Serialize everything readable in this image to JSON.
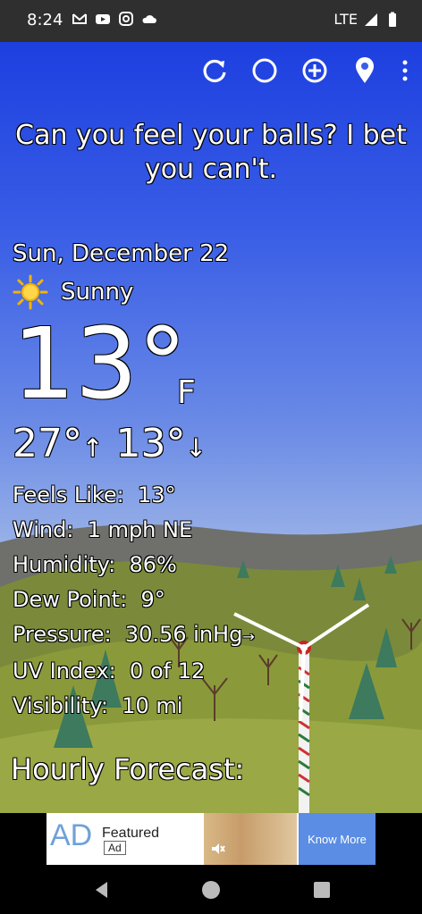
{
  "status_bar": {
    "time": "8:24",
    "network": "LTE",
    "left_icons": [
      "gmail-icon",
      "youtube-icon",
      "instagram-icon",
      "cloud-icon"
    ],
    "right_icons": [
      "signal-icon",
      "battery-icon"
    ]
  },
  "toolbar": {
    "icons": [
      "refresh-icon",
      "theme-icon",
      "add-location-icon",
      "location-pin-icon",
      "overflow-menu-icon"
    ]
  },
  "weather": {
    "message": "Can you feel your balls? I bet you can't.",
    "date": "Sun, December 22",
    "condition": "Sunny",
    "condition_icon": "sun-icon",
    "temperature": "13°",
    "unit": "F",
    "high": "27°",
    "low": "13°",
    "high_arrow": "↑",
    "low_arrow": "↓",
    "details": [
      {
        "label": "Feels Like:",
        "value": "13°"
      },
      {
        "label": "Wind:",
        "value": "1 mph NE"
      },
      {
        "label": "Humidity:",
        "value": "86%"
      },
      {
        "label": "Dew Point:",
        "value": "9°"
      },
      {
        "label": "Pressure:",
        "value": "30.56 inHg",
        "suffix": "→"
      },
      {
        "label": "UV Index:",
        "value": "0 of 12"
      },
      {
        "label": "Visibility:",
        "value": "10 mi"
      }
    ],
    "hourly_title": "Hourly Forecast:"
  },
  "ad": {
    "logo": "AD",
    "featured": "Featured",
    "tag": "Ad",
    "cta": "Know More"
  },
  "colors": {
    "sky_top": "#1d3fe0",
    "hill_green": "#8a9a3a",
    "status_bar": "#2f2f2f",
    "ad_cta": "#5a8de3"
  }
}
